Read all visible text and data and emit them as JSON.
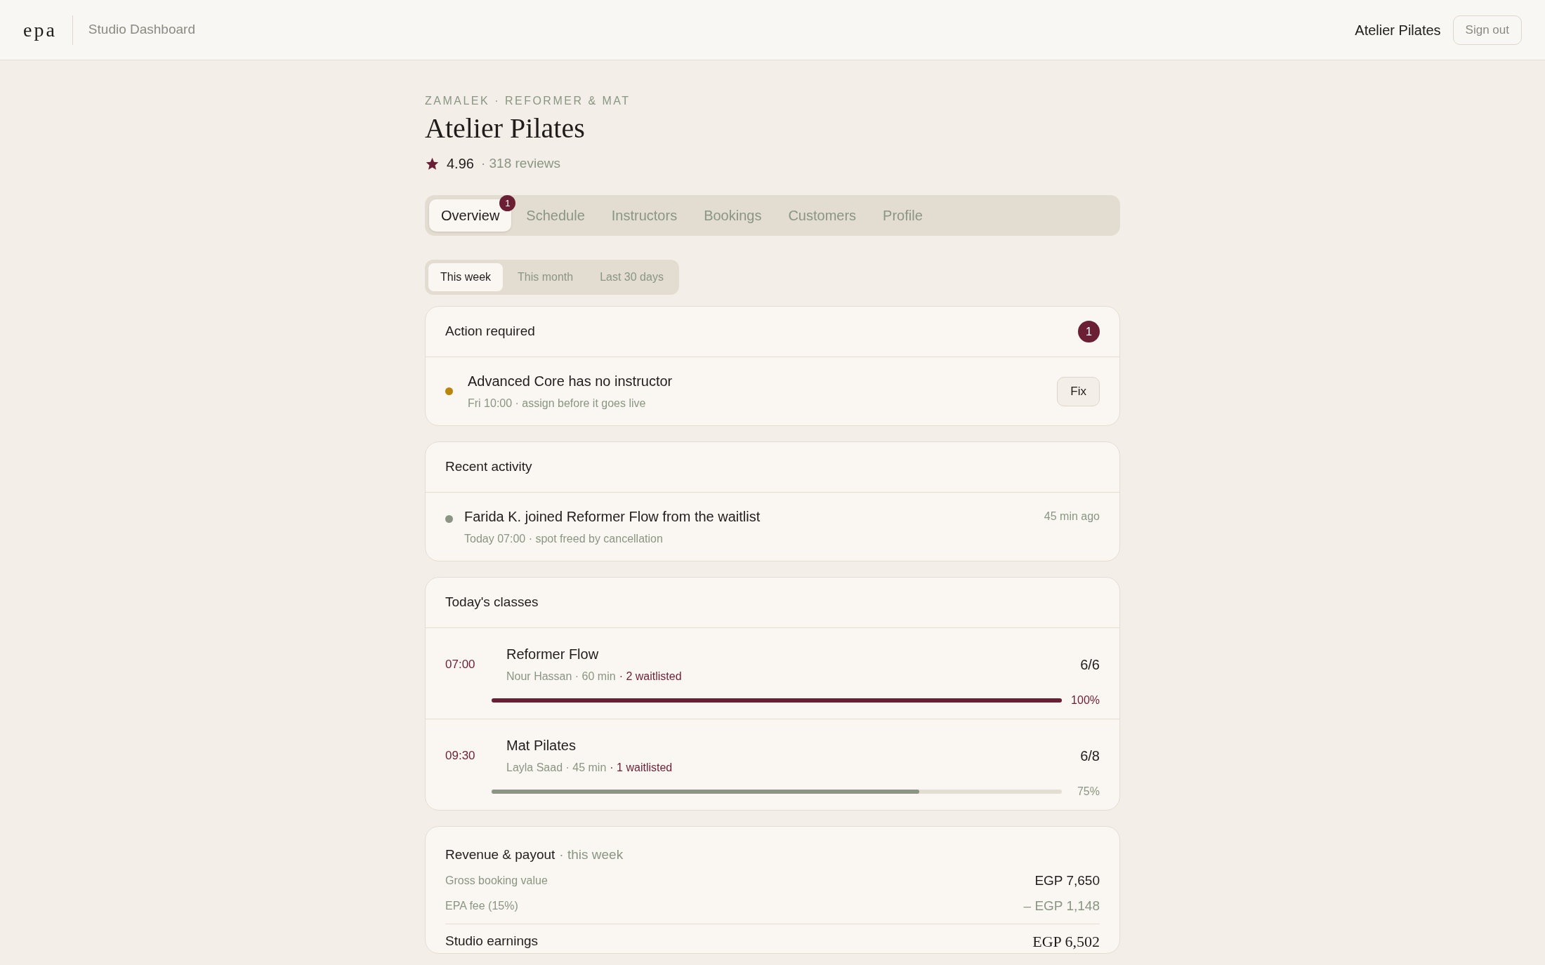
{
  "header": {
    "logo": "epa",
    "title": "Studio Dashboard",
    "studio_name": "Atelier Pilates",
    "sign_out": "Sign out"
  },
  "studio": {
    "eyebrow": "ZAMALEK · REFORMER & MAT",
    "name": "Atelier Pilates",
    "rating": "4.96",
    "reviews": "· 318 reviews"
  },
  "tabs": [
    {
      "label": "Overview",
      "selected": true,
      "badge": "1"
    },
    {
      "label": "Schedule",
      "selected": false
    },
    {
      "label": "Instructors",
      "selected": false
    },
    {
      "label": "Bookings",
      "selected": false
    },
    {
      "label": "Customers",
      "selected": false
    },
    {
      "label": "Profile",
      "selected": false
    }
  ],
  "periods": [
    {
      "label": "This week",
      "selected": true
    },
    {
      "label": "This month",
      "selected": false
    },
    {
      "label": "Last 30 days",
      "selected": false
    }
  ],
  "action_required": {
    "title": "Action required",
    "count": "1",
    "items": [
      {
        "color": "#b8860b",
        "title": "Advanced Core has no instructor",
        "detail": "Fri 10:00 · assign before it goes live",
        "button": "Fix"
      }
    ]
  },
  "recent_activity": {
    "title": "Recent activity",
    "items": [
      {
        "color": "#8a9583",
        "title": "Farida K. joined Reformer Flow from the waitlist",
        "detail": "Today 07:00 · spot freed by cancellation",
        "time": "45 min ago"
      }
    ]
  },
  "todays_classes": {
    "title": "Today's classes",
    "items": [
      {
        "time": "07:00",
        "name": "Reformer Flow",
        "meta": "Nour Hassan · 60 min",
        "waitlist": "· 2 waitlisted",
        "capacity": "6/6",
        "level": 1.0,
        "percent": "100%",
        "full": true
      },
      {
        "time": "09:30",
        "name": "Mat Pilates",
        "meta": "Layla Saad · 45 min",
        "waitlist": "· 1 waitlisted",
        "capacity": "6/8",
        "level": 0.75,
        "percent": "75%",
        "full": false
      }
    ]
  },
  "revenue": {
    "title": "Revenue & payout",
    "period": "· this week",
    "rows": [
      {
        "kind": "gross",
        "label": "Gross booking value",
        "value": "EGP 7,650"
      },
      {
        "kind": "fee",
        "label": "EPA fee (15%)",
        "value": "– EGP 1,148"
      },
      {
        "kind": "total",
        "label": "Studio earnings",
        "value": "EGP 6,502"
      }
    ]
  }
}
